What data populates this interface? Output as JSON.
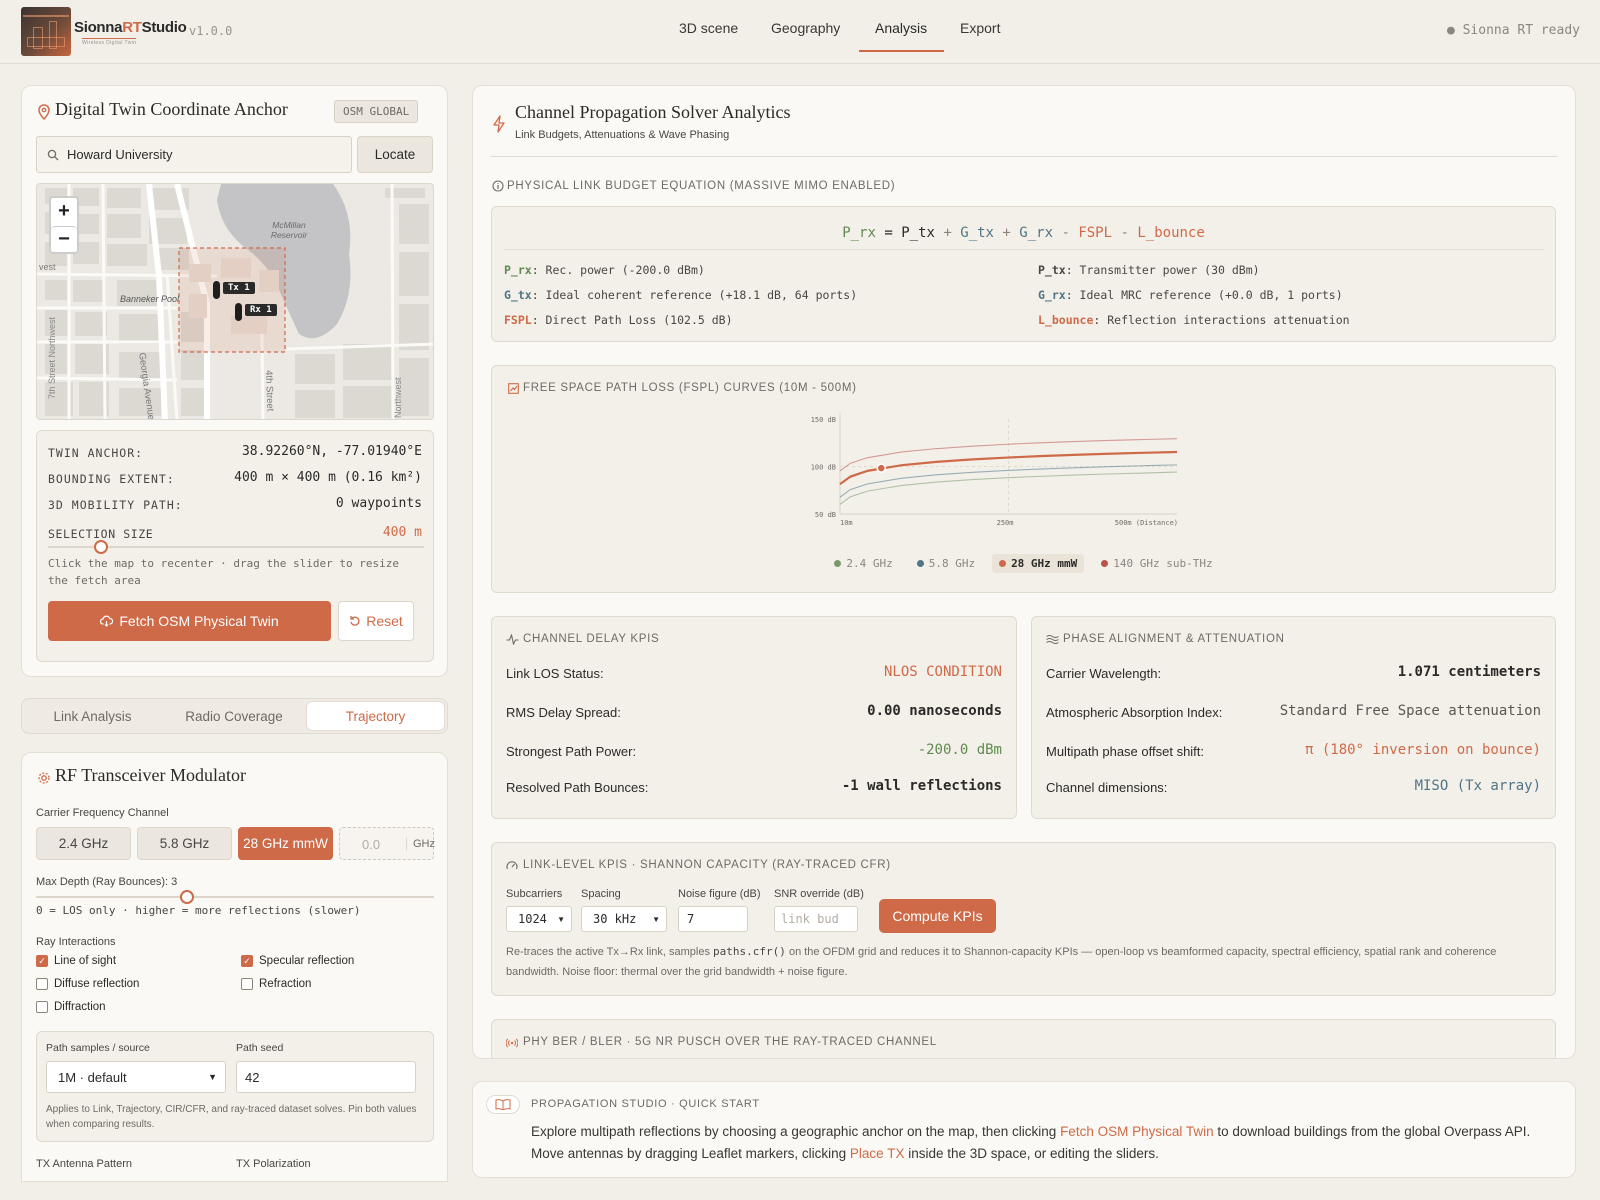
{
  "header": {
    "brand": {
      "part1": "Sionna",
      "part2": "RT",
      "part3": "Studio",
      "tagline": "Wireless Digital Twin"
    },
    "version": "v1.0.0",
    "nav": [
      {
        "label": "3D scene"
      },
      {
        "label": "Geography"
      },
      {
        "label": "Analysis",
        "active": true
      },
      {
        "label": "Export"
      }
    ],
    "status": "● Sionna RT ready"
  },
  "anchor": {
    "title": "Digital Twin Coordinate Anchor",
    "badge": "OSM GLOBAL",
    "search_value": "Howard University",
    "locate_label": "Locate",
    "map": {
      "zoom_in": "+",
      "zoom_out": "−",
      "labels": [
        "McMillan Reservoir",
        "Banneker Pool",
        "Georgia Avenue Nor",
        "4th Street",
        "7th Street Northwest",
        "Northwest",
        "vest"
      ],
      "markers": [
        {
          "label": "Tx 1"
        },
        {
          "label": "Rx 1"
        }
      ]
    },
    "twin_anchor_label": "TWIN ANCHOR:",
    "twin_anchor_value": "38.92260°N, -77.01940°E",
    "bbox_label": "BOUNDING EXTENT:",
    "bbox_value": "400 m × 400 m (0.16 km²)",
    "path_label": "3D MOBILITY PATH:",
    "path_value": "0 waypoints",
    "selection_label": "SELECTION SIZE",
    "selection_value": "400 m",
    "selection_fraction": 0.14,
    "hint": "Click the map to recenter · drag the slider to resize the fetch area",
    "fetch_label": "Fetch OSM Physical Twin",
    "reset_label": "Reset"
  },
  "tabs": [
    {
      "label": "Link Analysis"
    },
    {
      "label": "Radio Coverage"
    },
    {
      "label": "Trajectory",
      "active": true
    }
  ],
  "rf": {
    "title": "RF Transceiver Modulator",
    "freq_label": "Carrier Frequency Channel",
    "freqs": [
      {
        "label": "2.4 GHz"
      },
      {
        "label": "5.8 GHz"
      },
      {
        "label": "28 GHz mmW",
        "active": true
      }
    ],
    "custom_placeholder": "0.0",
    "custom_unit": "GHz",
    "depth_label": "Max Depth (Ray Bounces): 3",
    "depth_fraction": 0.38,
    "depth_hint": "0 = LOS only · higher = more reflections (slower)",
    "interactions_label": "Ray Interactions",
    "interactions": [
      {
        "label": "Line of sight",
        "checked": true
      },
      {
        "label": "Specular reflection",
        "checked": true
      },
      {
        "label": "Diffuse reflection",
        "checked": false
      },
      {
        "label": "Refraction",
        "checked": false
      },
      {
        "label": "Diffraction",
        "checked": false
      }
    ],
    "samples_label": "Path samples / source",
    "samples_value": "1M · default",
    "seed_label": "Path seed",
    "seed_value": "42",
    "samples_hint": "Applies to Link, Trajectory, CIR/CFR, and ray-traced dataset solves. Pin both values when comparing results.",
    "antenna_label": "TX Antenna Pattern",
    "polarization_label": "TX Polarization"
  },
  "analytics": {
    "title": "Channel Propagation Solver Analytics",
    "subtitle": "Link Budgets, Attenuations & Wave Phasing",
    "budget_head": "PHYSICAL LINK BUDGET EQUATION (MASSIVE MIMO ENABLED)",
    "equation": {
      "prx": "P_rx",
      "eq": "=",
      "ptx": "P_tx",
      "plus1": "+",
      "gtx": "G_tx",
      "plus2": "+",
      "grx": "G_rx",
      "minus1": "-",
      "fspl": "FSPL",
      "minus2": "-",
      "lb": "L_bounce"
    },
    "terms": [
      {
        "sym": "P_rx",
        "desc": ": Rec. power (-200.0 dBm)",
        "color": "#5f8a4e"
      },
      {
        "sym": "P_tx",
        "desc": ": Transmitter power (30 dBm)",
        "color": "#2c2a28"
      },
      {
        "sym": "G_tx",
        "desc": ": Ideal coherent reference (+18.1 dB, 64 ports)",
        "color": "#4f7586"
      },
      {
        "sym": "G_rx",
        "desc": ": Ideal MRC reference (+0.0 dB, 1 ports)",
        "color": "#4f7586"
      },
      {
        "sym": "FSPL",
        "desc": ": Direct Path Loss (102.5 dB)",
        "color": "#cf6a48"
      },
      {
        "sym": "L_bounce",
        "desc": ": Reflection interactions attenuation",
        "color": "#cf6a48"
      }
    ],
    "fspl_head": "FREE SPACE PATH LOSS (FSPL) CURVES (10M - 500M)",
    "delay_head": "CHANNEL DELAY KPIS",
    "delay": [
      {
        "label": "Link LOS Status:",
        "value": "NLOS CONDITION",
        "color": "#cf6a48"
      },
      {
        "label": "RMS Delay Spread:",
        "value": "0.00 nanoseconds",
        "color": "#2c2a28"
      },
      {
        "label": "Strongest Path Power:",
        "value": "-200.0 dBm",
        "color": "#5f8a4e"
      },
      {
        "label": "Resolved Path Bounces:",
        "value": "-1 wall reflections",
        "color": "#2c2a28"
      }
    ],
    "phase_head": "PHASE ALIGNMENT & ATTENUATION",
    "phase": [
      {
        "label": "Carrier Wavelength:",
        "value": "1.071 centimeters",
        "color": "#2c2a28"
      },
      {
        "label": "Atmospheric Absorption Index:",
        "value": "Standard Free Space attenuation",
        "color": "#5b5650"
      },
      {
        "label": "Multipath phase offset shift:",
        "value": "π (180° inversion on bounce)",
        "color": "#cf6a48"
      },
      {
        "label": "Channel dimensions:",
        "value": "MISO (Tx array)",
        "color": "#4f7586"
      }
    ],
    "kpi_head": "LINK-LEVEL KPIS · SHANNON CAPACITY (RAY-TRACED CFR)",
    "kpi": {
      "subcarriers_label": "Subcarriers",
      "subcarriers_value": "1024",
      "spacing_label": "Spacing",
      "spacing_value": "30 kHz",
      "noise_label": "Noise figure (dB)",
      "noise_value": "7",
      "snr_label": "SNR override (dB)",
      "snr_placeholder": "link bud",
      "compute_label": "Compute KPIs",
      "desc1": "Re-traces the active Tx→Rx link, samples ",
      "desc_code": "paths.cfr()",
      "desc2": " on the OFDM grid and reduces it to Shannon-capacity KPIs — open-loop vs beamformed capacity, spectral efficiency, spatial rank and coherence bandwidth. Noise floor: thermal over the grid bandwidth + noise figure."
    },
    "ber_head": "PHY BER / BLER · 5G NR PUSCH OVER THE RAY-TRACED CHANNEL"
  },
  "quickstart": {
    "head": "PROPAGATION STUDIO · QUICK START",
    "t1": "Explore multipath reflections by choosing a geographic anchor on the map, then clicking ",
    "link1": "Fetch OSM Physical Twin",
    "t2": " to download buildings from the global Overpass API. Move antennas by dragging Leaflet markers, clicking ",
    "link2": "Place TX",
    "t3": " inside the 3D space, or editing the sliders."
  },
  "chart_data": {
    "type": "line",
    "title": "",
    "ylabel": "",
    "xlabel": "",
    "x_ticks": [
      "10m",
      "250m",
      "500m (Distance)"
    ],
    "y_ticks": [
      "150 dB",
      "100 dB",
      "50 dB"
    ],
    "xlim": [
      10,
      500
    ],
    "ylim": [
      50,
      150
    ],
    "x": [
      10,
      25,
      50,
      100,
      150,
      200,
      250,
      300,
      350,
      400,
      450,
      500
    ],
    "series": [
      {
        "name": "2.4 GHz",
        "color": "#7a9a6c",
        "active": false,
        "values": [
          60.1,
          68.1,
          74.1,
          80.1,
          83.6,
          86.1,
          88.1,
          89.6,
          91.0,
          92.1,
          93.1,
          94.1
        ]
      },
      {
        "name": "5.8 GHz",
        "color": "#4f7586",
        "active": false,
        "values": [
          67.7,
          75.7,
          81.7,
          87.7,
          91.2,
          93.7,
          95.7,
          97.3,
          98.6,
          99.8,
          100.8,
          101.7
        ]
      },
      {
        "name": "28 GHz mmW",
        "color": "#cf6a48",
        "active": true,
        "values": [
          81.4,
          89.3,
          95.4,
          101.4,
          104.9,
          107.4,
          109.3,
          110.9,
          112.2,
          113.4,
          114.4,
          115.3
        ]
      },
      {
        "name": "140 GHz sub-THz",
        "color": "#b8534a",
        "active": false,
        "values": [
          95.3,
          103.3,
          109.3,
          115.3,
          118.8,
          121.3,
          123.3,
          124.9,
          126.2,
          127.4,
          128.4,
          129.3
        ]
      }
    ],
    "marker": {
      "x": 70,
      "y": 98.3
    },
    "grid": false,
    "legend_position": "bottom"
  }
}
